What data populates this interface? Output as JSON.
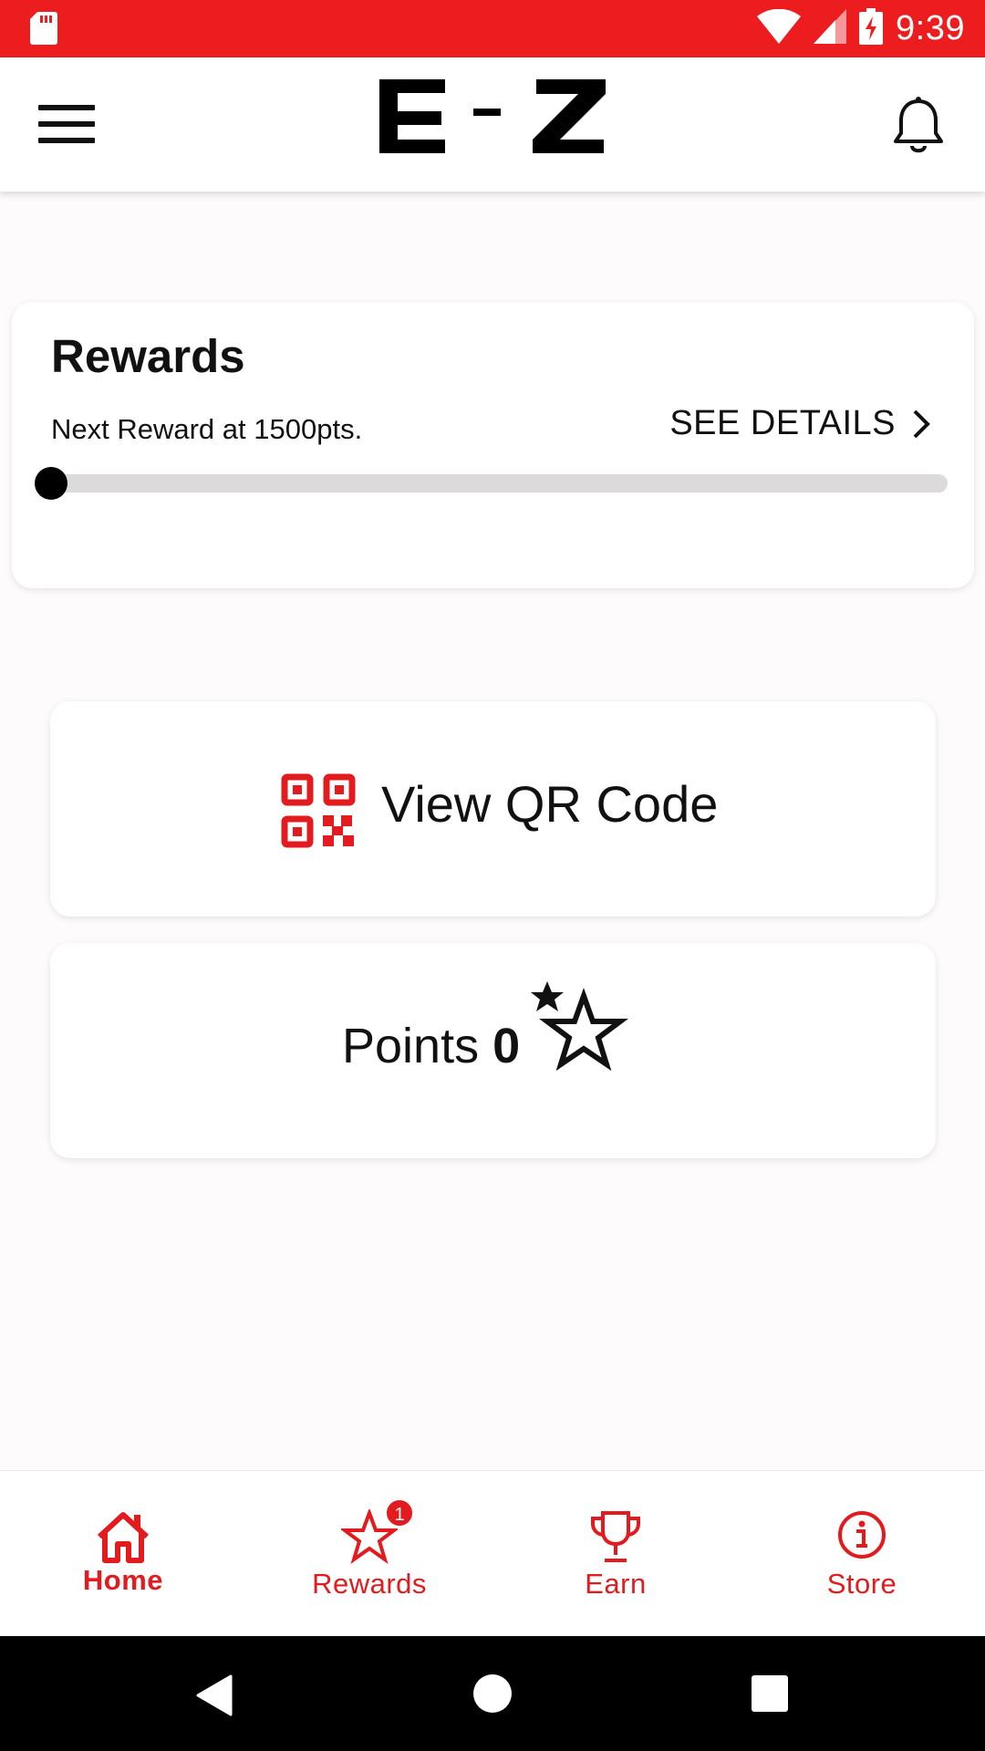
{
  "status_bar": {
    "time": "9:39",
    "background_color": "#ec1c1f",
    "icons": [
      "sd-card-icon",
      "wifi-icon",
      "cell-signal-icon",
      "battery-charging-icon"
    ]
  },
  "app_bar": {
    "logo_text": "E-Z",
    "menu_icon": "hamburger-menu-icon",
    "notification_icon": "bell-icon"
  },
  "rewards": {
    "title": "Rewards",
    "next_reward": "Next Reward at 1500pts.",
    "see_details": "SEE DETAILS",
    "progress": 0
  },
  "qr": {
    "label": "View QR Code",
    "icon": "qr-code-icon"
  },
  "points": {
    "label": "Points",
    "value": "0",
    "icon": "stars-icon"
  },
  "bottom_nav": {
    "items": [
      {
        "label": "Home",
        "icon": "home-icon",
        "active": true
      },
      {
        "label": "Rewards",
        "icon": "star-icon",
        "badge": "1"
      },
      {
        "label": "Earn",
        "icon": "trophy-icon"
      },
      {
        "label": "Store",
        "icon": "info-icon"
      }
    ]
  },
  "colors": {
    "accent": "#e41b1e",
    "text": "#111111"
  }
}
